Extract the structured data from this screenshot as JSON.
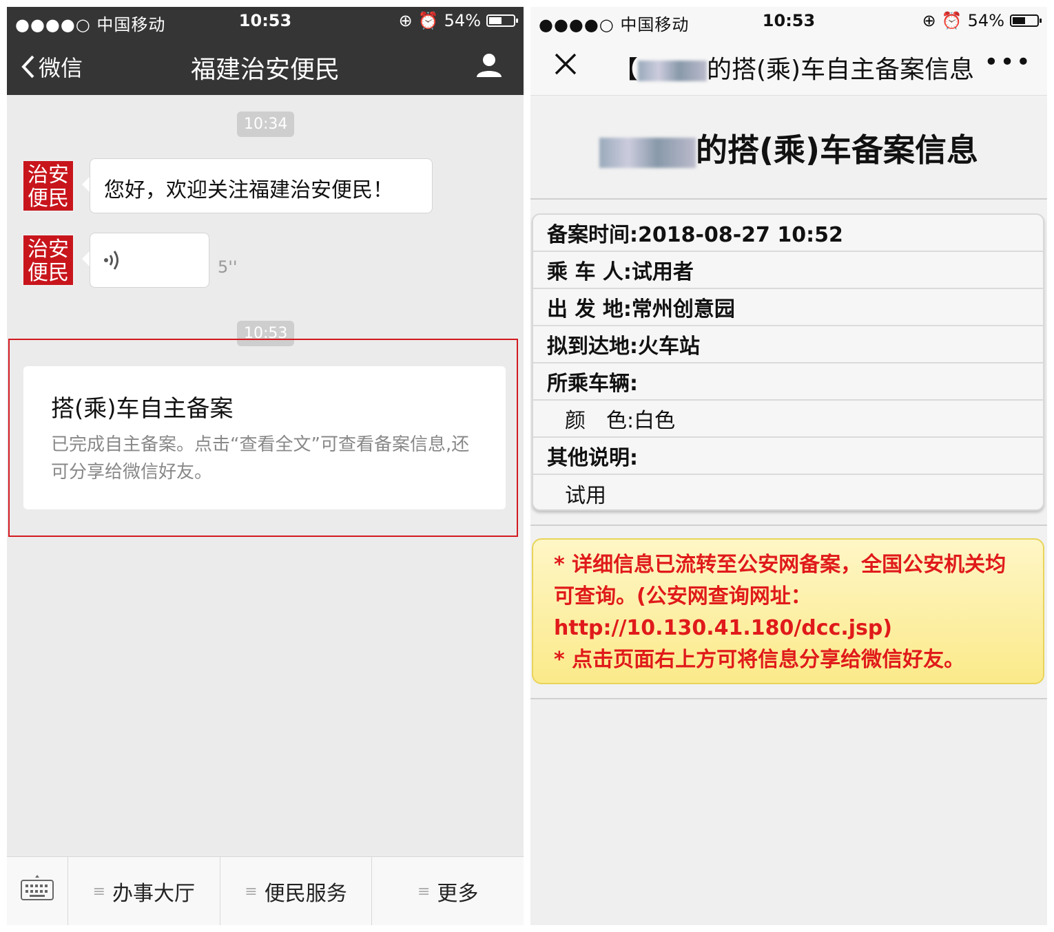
{
  "status_bar": {
    "signal": "●●●●○ 中国移动",
    "time": "10:53",
    "battery": "54%",
    "battery_level": 0.54
  },
  "left": {
    "nav": {
      "back_label": "微信",
      "title": "福建治安便民"
    },
    "chat": {
      "timestamp1": "10:34",
      "avatar_text": "治安便民",
      "message1": "您好，欢迎关注福建治安便民！",
      "voice_duration": "5''",
      "timestamp2": "10:53",
      "card_title": "搭(乘)车自主备案",
      "card_desc": "已完成自主备案。点击“查看全文”可查看备案信息,还可分享给微信好友。"
    },
    "menu": {
      "items": [
        "办事大厅",
        "便民服务",
        "更多"
      ]
    }
  },
  "right": {
    "nav": {
      "title_prefix": "【",
      "title_text": "的搭(乘)车自主备案信息"
    },
    "page_title": "的搭(乘)车备案信息",
    "rows": [
      "备案时间:2018-08-27 10:52",
      "乘 车 人:试用者",
      "出 发 地:常州创意园",
      "拟到达地:火车站",
      "所乘车辆:",
      "颜　色:白色",
      "其他说明:",
      "试用"
    ],
    "notice": [
      "* 详细信息已流转至公安网备案，全国公安机关均可查询。(公安网查询网址：http://10.130.41.180/dcc.jsp)",
      "* 点击页面右上方可将信息分享给微信好友。"
    ]
  }
}
